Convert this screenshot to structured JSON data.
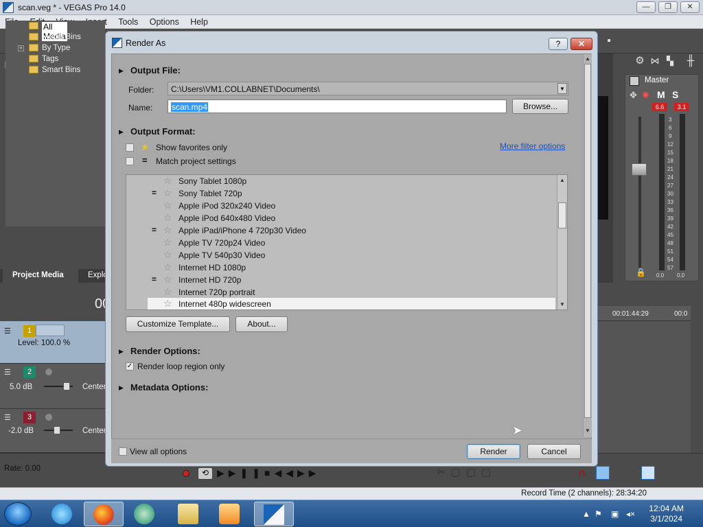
{
  "app": {
    "title": "scan.veg * - VEGAS Pro 14.0",
    "menu": [
      "File",
      "Edit",
      "View",
      "Insert",
      "Tools",
      "Options",
      "Help"
    ]
  },
  "media_tree": {
    "items": [
      "All Media",
      "Media Bins",
      "By Type",
      "Tags",
      "Smart Bins"
    ],
    "tabs": [
      "Project Media",
      "Explo"
    ]
  },
  "timecode_partial": "00",
  "master": {
    "label": "Master",
    "m_label": "M",
    "s_label": "S",
    "peak_left": "6.6",
    "peak_right": "3.1",
    "scale": [
      "3",
      "6",
      "9",
      "12",
      "15",
      "18",
      "21",
      "24",
      "27",
      "30",
      "33",
      "36",
      "39",
      "42",
      "45",
      "48",
      "51",
      "54",
      "57"
    ],
    "bottom_left": "0.0",
    "bottom_right": "0.0"
  },
  "tracks": [
    {
      "num": "1",
      "label": "Level: 100.0 %"
    },
    {
      "num": "2",
      "label": "5.0 dB",
      "pan": "Center"
    },
    {
      "num": "3",
      "label": "-2.0 dB",
      "pan": "Center"
    }
  ],
  "ruler": {
    "t1": "00:01:44:29",
    "t2": "00:0"
  },
  "rate": "Rate: 0.00",
  "status": {
    "record_time": "Record Time (2 channels): 28:34:20"
  },
  "clock": {
    "time": "12:04 AM",
    "date": "3/1/2024"
  },
  "dialog": {
    "title": "Render As",
    "help": "?",
    "close": "✕",
    "output_file": {
      "header": "Output File:",
      "folder_label": "Folder:",
      "folder_value": "C:\\Users\\VM1.COLLABNET\\Documents\\",
      "name_label": "Name:",
      "name_value": "scan.mp4",
      "browse": "Browse..."
    },
    "output_format": {
      "header": "Output Format:",
      "show_favorites": "Show favorites only",
      "match_project": "Match project settings",
      "more_filter": "More filter options"
    },
    "templates": [
      {
        "name": "Sony Tablet 1080p",
        "eq": false
      },
      {
        "name": "Sony Tablet 720p",
        "eq": true
      },
      {
        "name": "Apple iPod 320x240 Video",
        "eq": false
      },
      {
        "name": "Apple iPod 640x480 Video",
        "eq": false
      },
      {
        "name": "Apple iPad/iPhone 4 720p30 Video",
        "eq": true
      },
      {
        "name": "Apple TV 720p24 Video",
        "eq": false
      },
      {
        "name": "Apple TV 540p30 Video",
        "eq": false
      },
      {
        "name": "Internet HD 1080p",
        "eq": false
      },
      {
        "name": "Internet HD 720p",
        "eq": true
      },
      {
        "name": "Internet 720p portrait",
        "eq": false
      },
      {
        "name": "Internet 480p widescreen",
        "eq": false
      }
    ],
    "customize": "Customize Template...",
    "about": "About...",
    "render_options": {
      "header": "Render Options:",
      "loop_only": "Render loop region only"
    },
    "metadata": {
      "header": "Metadata Options:"
    },
    "view_all": "View all options",
    "render": "Render",
    "cancel": "Cancel"
  },
  "colors": {
    "accent": "#3399ff",
    "link": "#1f4fb8",
    "peak": "#d21f1f"
  }
}
